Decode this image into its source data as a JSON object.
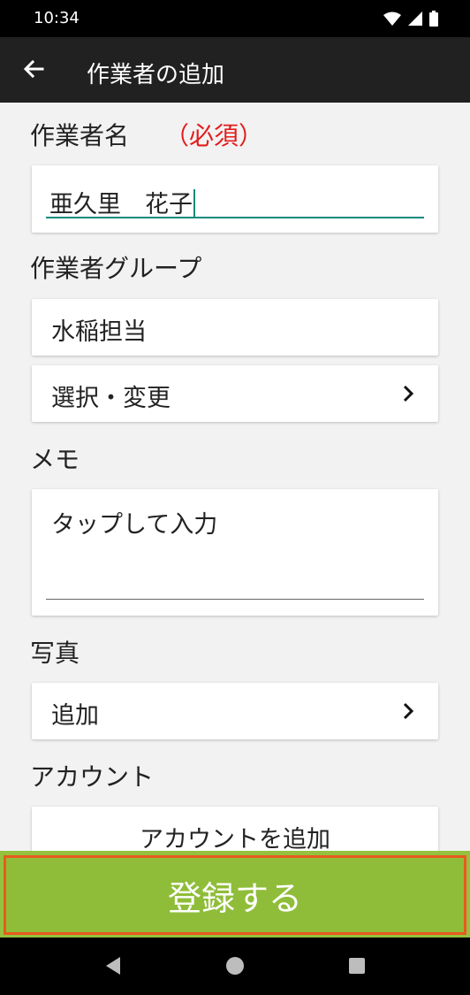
{
  "status": {
    "time": "10:34",
    "icons": [
      "wifi-icon",
      "signal-icon",
      "battery-icon"
    ]
  },
  "appbar": {
    "title": "作業者の追加",
    "back_icon": "arrow-left-icon"
  },
  "form": {
    "name_label": "作業者名",
    "required_label": "（必須）",
    "name_value": "亜久里　花子",
    "group_label": "作業者グループ",
    "group_value": "水稲担当",
    "group_select": "選択・変更",
    "memo_label": "メモ",
    "memo_placeholder": "タップして入力",
    "photo_label": "写真",
    "photo_add": "追加",
    "account_label": "アカウント",
    "account_add": "アカウントを追加"
  },
  "submit": {
    "label": "登録する"
  },
  "colors": {
    "accent": "#138a7e",
    "required": "#e31c1c",
    "submit_bg": "#8fbd3a",
    "highlight": "#e85a1e"
  }
}
